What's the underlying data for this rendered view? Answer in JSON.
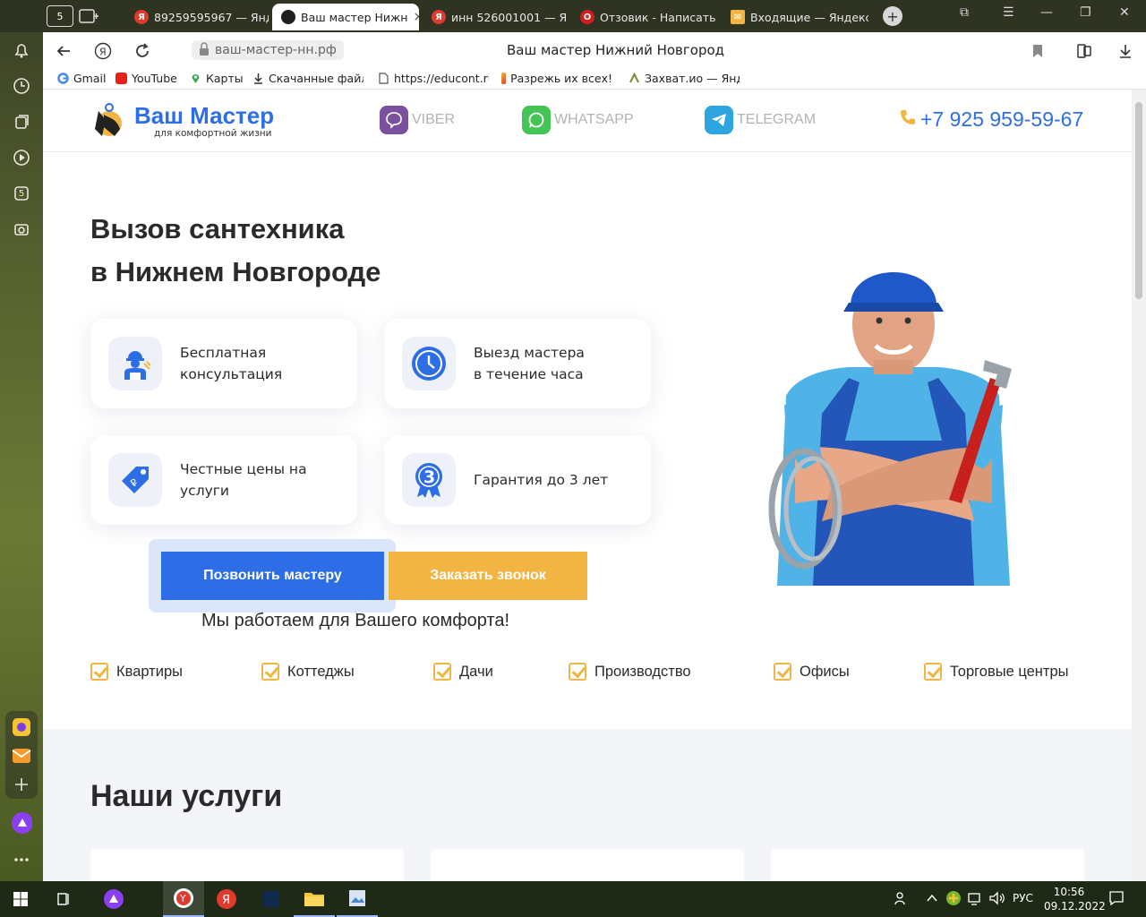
{
  "browser": {
    "tabs": [
      {
        "label": "89259595967 — Янд",
        "favicon": "yandex-icon",
        "color": "#e03a2e"
      },
      {
        "label": "Ваш мастер Нижн",
        "favicon": "site-logo-icon",
        "color": "#2d6ee6",
        "active": true
      },
      {
        "label": "инн 526001001 — Я",
        "favicon": "yandex-icon",
        "color": "#e03a2e"
      },
      {
        "label": "Отзовик - Написать",
        "favicon": "otzovik-icon",
        "color": "#d31d1d"
      },
      {
        "label": "Входящие — Яндекс",
        "favicon": "mail-icon",
        "color": "#f2b544"
      }
    ],
    "tab_count_badge": "5",
    "url": "ваш-мастер-нн.рф",
    "page_title": "Ваш мастер Нижний Новгород",
    "bookmarks": [
      {
        "label": "Gmail",
        "icon": "google-icon"
      },
      {
        "label": "YouTube",
        "icon": "youtube-icon"
      },
      {
        "label": "Карты",
        "icon": "maps-icon"
      },
      {
        "label": "Скачанные файлы",
        "icon": "download-icon"
      },
      {
        "label": "https://educont.ru",
        "icon": "page-icon"
      },
      {
        "label": "Разрежь их всех!",
        "icon": "game-icon"
      },
      {
        "label": "Захват.ио — Янде",
        "icon": "zahvat-icon"
      }
    ],
    "sidebar_badge": "5"
  },
  "site": {
    "logo_title": "Ваш Мастер",
    "logo_sub": "для комфортной жизни",
    "messengers": [
      {
        "label": "VIBER",
        "color": "#7b519d"
      },
      {
        "label": "WHATSAPP",
        "color": "#43c553"
      },
      {
        "label": "TELEGRAM",
        "color": "#2ca5e0"
      }
    ],
    "phone": "+7 925 959-59-67",
    "hero_title_line1": "Вызов сантехника",
    "hero_title_line2": "в Нижнем Новгороде",
    "features": [
      {
        "line1": "Бесплатная",
        "line2": "консультация",
        "icon": "worker-icon"
      },
      {
        "line1": "Выезд мастера",
        "line2": "в течение часа",
        "icon": "clock-icon"
      },
      {
        "line1": "Честные цены на",
        "line2": "услуги",
        "icon": "price-tag-icon"
      },
      {
        "line1": "Гарантия до 3 лет",
        "line2": "",
        "icon": "medal-icon"
      }
    ],
    "cta_call": "Позвонить мастеру",
    "cta_order": "Заказать звонок",
    "comfort": "Мы работаем для Вашего комфорта!",
    "objects": [
      "Квартиры",
      "Коттеджы",
      "Дачи",
      "Производство",
      "Офисы",
      "Торговые центры"
    ],
    "services_title": "Наши услуги",
    "accent_blue": "#2d6ee6",
    "accent_orange": "#f2b544"
  },
  "taskbar": {
    "lang": "РУС",
    "time": "10:56",
    "date": "09.12.2022"
  }
}
